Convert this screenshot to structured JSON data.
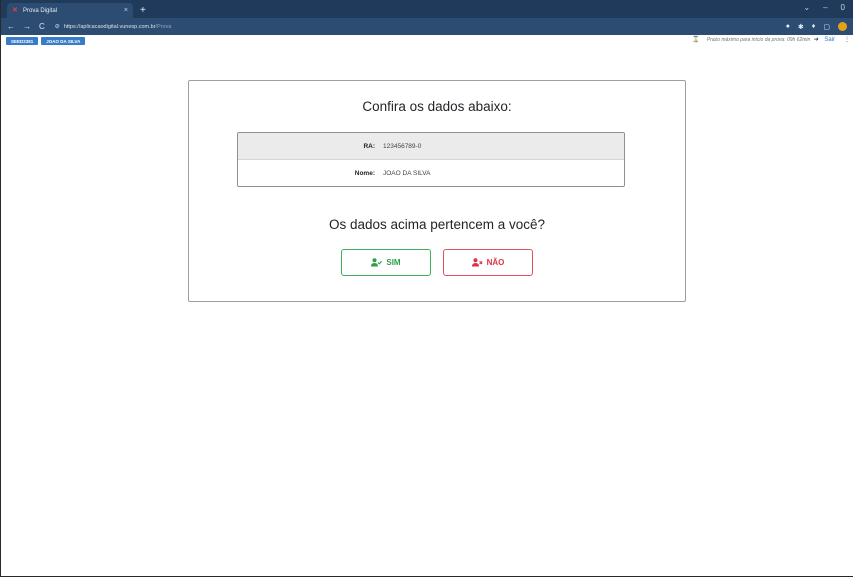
{
  "browser": {
    "tab_title": "Prova Digital",
    "tab_close": "×",
    "new_tab": "+",
    "window_controls": [
      "⌄",
      "–",
      "0"
    ],
    "url_host": "https://aplicacaodigital.vunesp.com.br",
    "url_path": "/Prova",
    "nav": {
      "back": "←",
      "forward": "→",
      "reload": "C"
    }
  },
  "appbar": {
    "badges": [
      "SEED2381",
      "JOAO DA SILVA"
    ],
    "deadline_text": "Prazo máximo para início da prova: 09h 62min",
    "logout_label": "Sair"
  },
  "card": {
    "title": "Confira os dados abaixo:",
    "rows": [
      {
        "label": "RA:",
        "value": "123456789-0"
      },
      {
        "label": "Nome:",
        "value": "JOAO DA SILVA"
      }
    ],
    "question": "Os dados acima pertencem a você?",
    "yes_label": "SIM",
    "no_label": "NÃO"
  },
  "colors": {
    "chrome_dark": "#1f3a5a",
    "chrome_light": "#2c4c72",
    "badge": "#3a7bc8",
    "yes": "#2f9e4b",
    "no": "#d93344"
  }
}
